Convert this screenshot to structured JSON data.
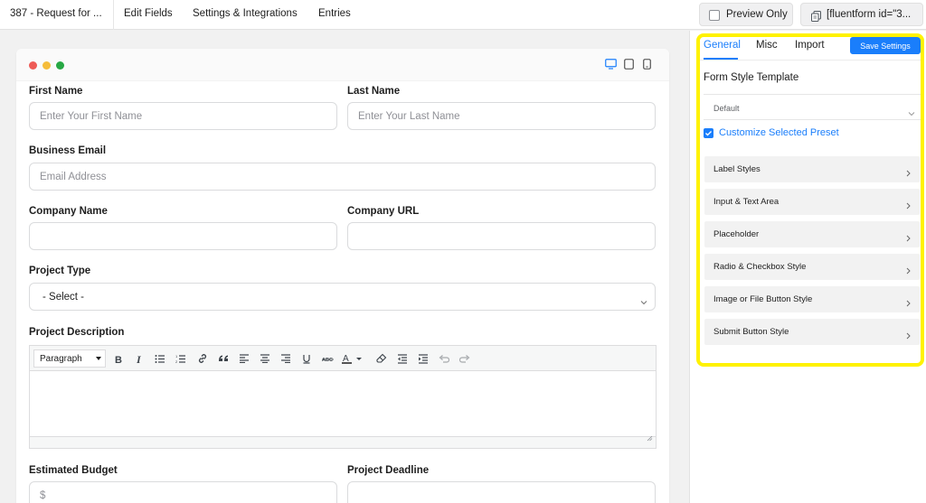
{
  "topbar": {
    "form_title": "387 - Request for ...",
    "nav": [
      "Edit Fields",
      "Settings & Integrations",
      "Entries"
    ],
    "preview_label": "Preview Only",
    "shortcode_label": "[fluentform id=\"3..."
  },
  "form": {
    "first_name": {
      "label": "First Name",
      "placeholder": "Enter Your First Name"
    },
    "last_name": {
      "label": "Last Name",
      "placeholder": "Enter Your Last Name"
    },
    "business_email": {
      "label": "Business Email",
      "placeholder": "Email Address"
    },
    "company_name": {
      "label": "Company Name",
      "placeholder": ""
    },
    "company_url": {
      "label": "Company URL",
      "placeholder": ""
    },
    "project_type": {
      "label": "Project Type",
      "value": "- Select -"
    },
    "project_description": {
      "label": "Project Description",
      "format_value": "Paragraph"
    },
    "estimated_budget": {
      "label": "Estimated Budget",
      "placeholder": "$"
    },
    "project_deadline": {
      "label": "Project Deadline",
      "placeholder": ""
    }
  },
  "panel": {
    "tabs": [
      "General",
      "Misc",
      "Import"
    ],
    "active_tab": "General",
    "save_label": "Save Settings",
    "section_title": "Form Style Template",
    "template_value": "Default",
    "customize_label": "Customize Selected Preset",
    "customize_checked": true,
    "accordion": [
      "Label Styles",
      "Input & Text Area",
      "Placeholder",
      "Radio & Checkbox Style",
      "Image or File Button Style",
      "Submit Button Style"
    ]
  },
  "colors": {
    "accent": "#1a7efb",
    "highlight": "#fff200",
    "dot_red": "#ee5b57",
    "dot_yellow": "#f5bd3a",
    "dot_green": "#27a844"
  },
  "icons": {
    "window_dots": [
      "red-dot",
      "yellow-dot",
      "green-dot"
    ],
    "devices": [
      "desktop-icon",
      "tablet-icon",
      "mobile-icon"
    ],
    "editor_toolbar": [
      "bold-icon",
      "italic-icon",
      "bullet-list-icon",
      "numbered-list-icon",
      "link-icon",
      "blockquote-icon",
      "align-left-icon",
      "align-center-icon",
      "align-right-icon",
      "underline-icon",
      "strikethrough-icon",
      "text-color-icon",
      "clear-formatting-icon",
      "outdent-icon",
      "indent-icon",
      "undo-icon",
      "redo-icon"
    ]
  }
}
